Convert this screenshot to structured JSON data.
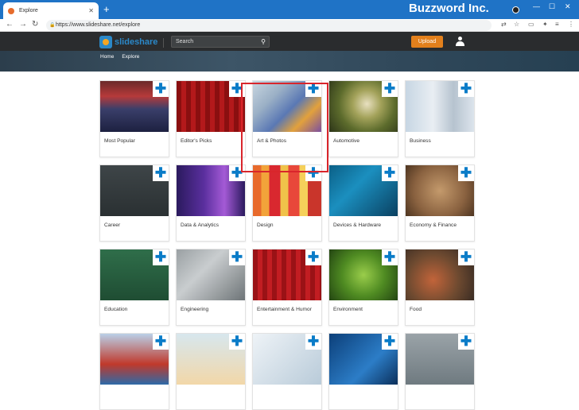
{
  "browser": {
    "tab_title": "Explore",
    "tab_close": "✕",
    "new_tab": "+",
    "url": "https://www.slideshare.net/explore",
    "brand": "Buzzword Inc."
  },
  "header": {
    "logo_text": "slideshare",
    "search_placeholder": "Search",
    "upload_label": "Upload",
    "nav": [
      "Home",
      "Explore"
    ]
  },
  "categories": [
    {
      "label": "Most Popular",
      "thumb": "conference-audience"
    },
    {
      "label": "Editor's Picks",
      "thumb": "star-award-stage"
    },
    {
      "label": "Art & Photos",
      "thumb": "paintbrush"
    },
    {
      "label": "Automotive",
      "thumb": "motion-blur-road"
    },
    {
      "label": "Business",
      "thumb": "business-people-walking"
    },
    {
      "label": "Career",
      "thumb": "chalkboard-stairs"
    },
    {
      "label": "Data & Analytics",
      "thumb": "purple-bars"
    },
    {
      "label": "Design",
      "thumb": "color-bars"
    },
    {
      "label": "Devices & Hardware",
      "thumb": "circuit-board"
    },
    {
      "label": "Economy & Finance",
      "thumb": "currency-symbols"
    },
    {
      "label": "Education",
      "thumb": "child-chalkboard"
    },
    {
      "label": "Engineering",
      "thumb": "gears"
    },
    {
      "label": "Entertainment & Humor",
      "thumb": "microphone-curtain"
    },
    {
      "label": "Environment",
      "thumb": "plant-hands"
    },
    {
      "label": "Food",
      "thumb": "food-spread"
    },
    {
      "label": "",
      "thumb": "flags"
    },
    {
      "label": "",
      "thumb": "yoga"
    },
    {
      "label": "",
      "thumb": "stethoscope"
    },
    {
      "label": "",
      "thumb": "world-map"
    },
    {
      "label": "",
      "thumb": "umbrella"
    }
  ],
  "plus_glyph": "✚"
}
